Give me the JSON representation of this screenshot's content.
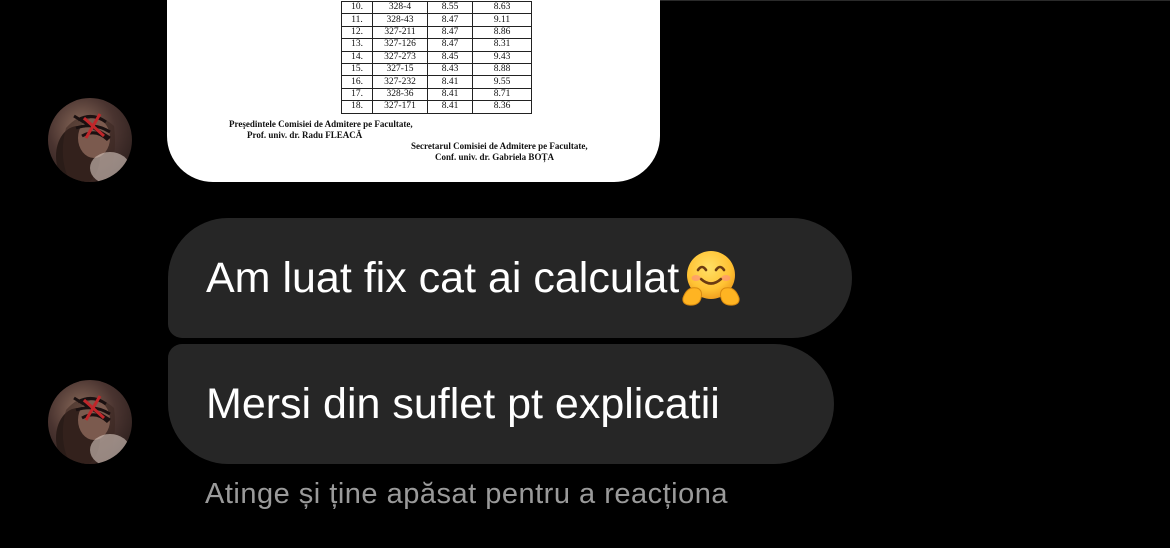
{
  "conversation": {
    "image_message": {
      "table_rows": [
        {
          "nr": "10.",
          "id": "328-4",
          "a": "8.55",
          "b": "8.63"
        },
        {
          "nr": "11.",
          "id": "328-43",
          "a": "8.47",
          "b": "9.11"
        },
        {
          "nr": "12.",
          "id": "327-211",
          "a": "8.47",
          "b": "8.86"
        },
        {
          "nr": "13.",
          "id": "327-126",
          "a": "8.47",
          "b": "8.31"
        },
        {
          "nr": "14.",
          "id": "327-273",
          "a": "8.45",
          "b": "9.43"
        },
        {
          "nr": "15.",
          "id": "327-15",
          "a": "8.43",
          "b": "8.88"
        },
        {
          "nr": "16.",
          "id": "327-232",
          "a": "8.41",
          "b": "9.55"
        },
        {
          "nr": "17.",
          "id": "328-36",
          "a": "8.41",
          "b": "8.71"
        },
        {
          "nr": "18.",
          "id": "327-171",
          "a": "8.41",
          "b": "8.36"
        }
      ],
      "signature_left_title": "Preşedintele Comisiei de Admitere pe Facultate,",
      "signature_left_name": "Prof. univ. dr. Radu FLEACĂ",
      "signature_right_title": "Secretarul Comisiei de Admitere pe Facultate,",
      "signature_right_name": "Conf. univ. dr. Gabriela BOȚA"
    },
    "messages": [
      {
        "text": "Am luat fix cat ai calculat",
        "emoji": "hugging-face-emoji"
      },
      {
        "text": "Mersi din suflet pt explicatii"
      }
    ],
    "reaction_hint": "Atinge și ține apăsat pentru a reacționa"
  },
  "colors": {
    "background": "#000000",
    "bubble": "#262626",
    "bubble_text": "#ffffff",
    "hint_text": "#9a9a9a"
  }
}
